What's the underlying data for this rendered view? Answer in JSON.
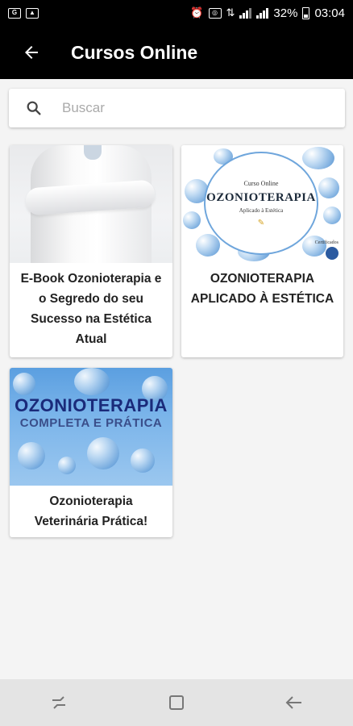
{
  "status_bar": {
    "battery": "32%",
    "time": "03:04",
    "left_icons": [
      "notification-icon",
      "image-icon"
    ],
    "right_icons": [
      "alarm-icon",
      "sync-icon",
      "data-icon",
      "signal-icon",
      "signal-icon",
      "battery-icon"
    ]
  },
  "app_bar": {
    "title": "Cursos Online",
    "back_icon": "arrow-left-icon"
  },
  "search": {
    "placeholder": "Buscar",
    "value": "",
    "icon": "search-icon"
  },
  "courses": [
    {
      "title": "E-Book Ozonioterapia e o Segredo do seu Sucesso na Estética Atual",
      "image": "doctor-white-coat"
    },
    {
      "title": "OZONIOTERAPIA APLICADO À ESTÉTICA",
      "image": "ozonioterapia-cover",
      "image_text": {
        "top": "Curso Online",
        "main": "OZONIOTERAPIA",
        "sub": "Aplicado à Estética",
        "cert": "Certificados"
      }
    },
    {
      "title": "Ozonioterapia Veterinária Prática!",
      "image": "ozonioterapia-completa-cover",
      "image_text": {
        "main": "OZONIOTERAPIA",
        "sub": "COMPLETA E PRÁTICA"
      }
    }
  ],
  "nav_bar": {
    "buttons": [
      "recent-apps-icon",
      "home-icon",
      "back-icon"
    ]
  },
  "colors": {
    "app_bar": "#000000",
    "background": "#f4f4f4",
    "card": "#ffffff",
    "nav_bar": "#e4e4e4"
  }
}
